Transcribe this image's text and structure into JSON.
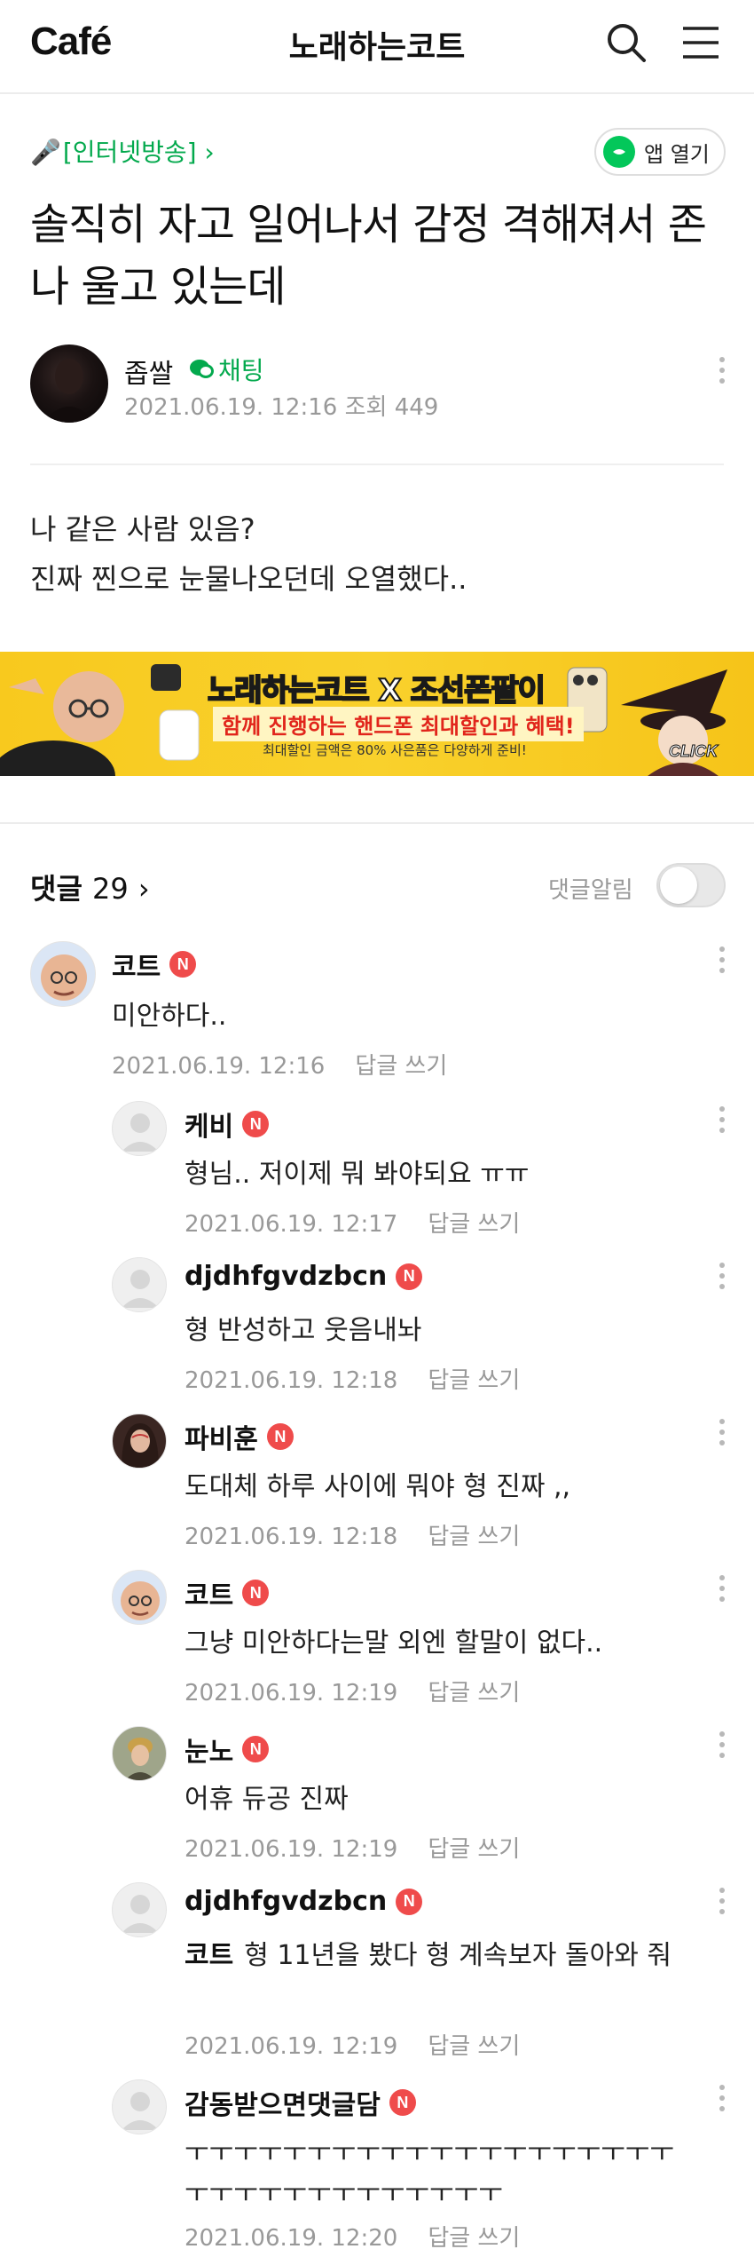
{
  "header": {
    "logo": "Café",
    "cafe_name": "노래하는코트"
  },
  "post": {
    "board": "[인터넷방송]",
    "board_arrow": "›",
    "app_open_label": "앱 열기",
    "title": "솔직히 자고 일어나서 감정 격해져서 존나 울고 있는데",
    "author": "좁쌀",
    "chat_label": "채팅",
    "date": "2021.06.19. 12:16",
    "views_label": "조회",
    "views": "449",
    "body_lines": [
      "나 같은 사람 있음?",
      "진짜 찐으로 눈물나오던데 오열했다.."
    ]
  },
  "banner": {
    "title": "노래하는코트 X 조선폰팔이",
    "subtitle": "함께 진행하는 핸드폰 최대할인과 혜택!",
    "note": "최대할인 금액은 80% 사은품은 다양하게 준비!",
    "click": "CLICK"
  },
  "comments_section": {
    "label": "댓글",
    "count": "29",
    "arrow": "›",
    "alert_label": "댓글알림",
    "alert_on": false,
    "reply_label": "답글 쓰기",
    "badge_label": "N",
    "items": [
      {
        "author": "코트",
        "text": "미안하다..",
        "date": "2021.06.19. 12:16"
      },
      {
        "author": "케비",
        "text": "형님.. 저이제 뭐 봐야되요 ㅠㅠ",
        "date": "2021.06.19. 12:17"
      },
      {
        "author": "djdhfgvdzbcn",
        "text": "형 반성하고 웃음내놔",
        "date": "2021.06.19. 12:18"
      },
      {
        "author": "파비훈",
        "text": "도대체 하루 사이에 뭐야 형 진짜 ,,",
        "date": "2021.06.19. 12:18"
      },
      {
        "author": "코트",
        "text": "그냥 미안하다는말 외엔 할말이 없다..",
        "date": "2021.06.19. 12:19"
      },
      {
        "author": "눈노",
        "text": "어휴 듀공 진짜",
        "date": "2021.06.19. 12:19"
      },
      {
        "author": "djdhfgvdzbcn",
        "mention": "코트",
        "text": "형 11년을 봤다 형 계속보자 돌아와 줘",
        "date": "2021.06.19. 12:19"
      },
      {
        "author": "감동받으면댓글담",
        "text": "ㅜㅜㅜㅜㅜㅜㅜㅜㅜㅜㅜㅜㅜㅜㅜㅜㅜㅜㅜㅜㅜㅜㅜㅜㅜㅜㅜㅜㅜㅜㅜㅜㅜ",
        "date": "2021.06.19. 12:20"
      }
    ]
  },
  "icons": {
    "search": "search-icon",
    "menu": "hamburger-menu-icon",
    "more": "more-vertical-icon",
    "mic": "microphone-icon",
    "chat": "chat-bubble-icon"
  },
  "colors": {
    "accent_green": "#03c75a",
    "link_green": "#03a94d",
    "new_badge": "#ef4b4b",
    "banner_yellow": "#f9d12c"
  }
}
